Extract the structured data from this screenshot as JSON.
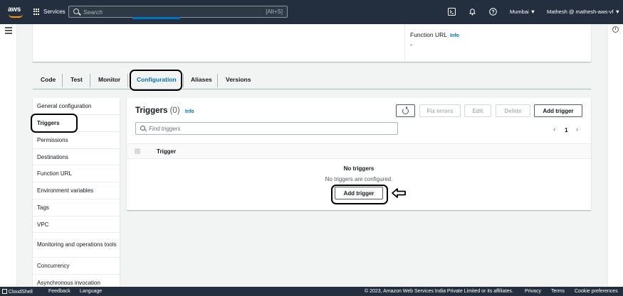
{
  "topnav": {
    "logo_text": "aws",
    "services_label": "Services",
    "search_placeholder": "Search",
    "search_shortcut": "[Alt+S]",
    "region": "Mumbai ▼",
    "account": "Mathesh @ mathesh-aws-vf ▼",
    "icons": [
      "cloudshell-icon",
      "bell-icon",
      "help-icon"
    ]
  },
  "function_url": {
    "label": "Function URL",
    "info": "Info",
    "value": "-"
  },
  "tabs": [
    {
      "label": "Code"
    },
    {
      "label": "Test"
    },
    {
      "label": "Monitor"
    },
    {
      "label": "Configuration",
      "active": true
    },
    {
      "label": "Aliases"
    },
    {
      "label": "Versions"
    }
  ],
  "sidebar": {
    "items": [
      {
        "label": "General configuration"
      },
      {
        "label": "Triggers",
        "active": true
      },
      {
        "label": "Permissions"
      },
      {
        "label": "Destinations"
      },
      {
        "label": "Function URL"
      },
      {
        "label": "Environment variables"
      },
      {
        "label": "Tags"
      },
      {
        "label": "VPC"
      },
      {
        "label": "Monitoring and operations tools"
      },
      {
        "label": "Concurrency"
      },
      {
        "label": "Asynchronous invocation"
      }
    ]
  },
  "triggers": {
    "title": "Triggers",
    "count": "(0)",
    "info": "Info",
    "buttons": {
      "fix_errors": "Fix errors",
      "edit": "Edit",
      "delete": "Delete",
      "add_trigger": "Add trigger"
    },
    "find_placeholder": "Find triggers",
    "page": "1",
    "column_header": "Trigger",
    "empty_title": "No triggers",
    "empty_subtitle": "No triggers are configured.",
    "empty_button": "Add trigger"
  },
  "footer": {
    "cloudshell": "CloudShell",
    "feedback": "Feedback",
    "language": "Language",
    "copyright": "© 2023, Amazon Web Services India Private Limited or its affiliates.",
    "privacy": "Privacy",
    "terms": "Terms",
    "cookie": "Cookie preferences"
  },
  "colors": {
    "nav_bg": "#232f3e",
    "accent": "#0073bb",
    "aws_orange": "#ff9900"
  }
}
